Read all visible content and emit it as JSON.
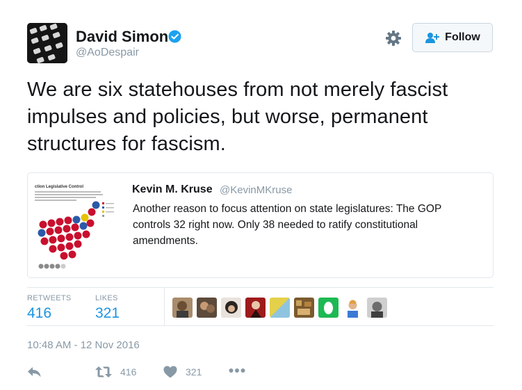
{
  "author": {
    "name": "David Simon",
    "handle": "@AoDespair",
    "verified": true
  },
  "header": {
    "follow_label": "Follow",
    "settings_icon": "gear-icon"
  },
  "tweet": {
    "text": "We are six statehouses from not merely fascist impulses and policies, but worse, permanent structures for fascism."
  },
  "quoted_tweet": {
    "name": "Kevin M. Kruse",
    "handle": "@KevinMKruse",
    "text": "Another reason to focus attention on state legislatures: The GOP controls 32 right now. Only 38 needed to ratify constitutional amendments.",
    "thumbnail_title": "ction Legislative Control"
  },
  "stats": {
    "retweets_label": "RETWEETS",
    "retweets_value": "416",
    "likes_label": "LIKES",
    "likes_value": "321"
  },
  "timestamp": "10:48 AM - 12 Nov 2016",
  "actions": {
    "retweet_count": "416",
    "like_count": "321"
  },
  "colors": {
    "accent": "#1b95e0",
    "muted": "#8899a6",
    "verified": "#1da1f2",
    "divider": "#e1e8ed"
  }
}
